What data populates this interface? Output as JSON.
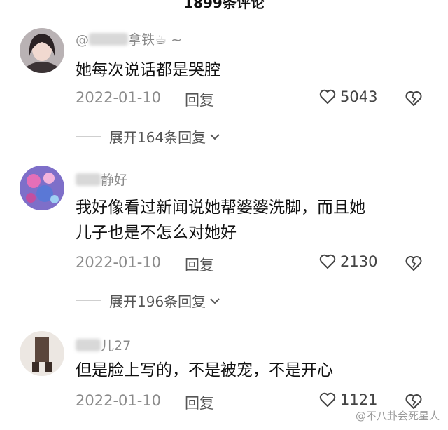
{
  "header": {
    "title": "1899条评论"
  },
  "comments": [
    {
      "username_suffix": "拿铁☕ ~",
      "text": "她每次说话都是哭腔",
      "date": "2022-01-10",
      "reply_label": "回复",
      "likes": "5043",
      "expand_label": "展开164条回复"
    },
    {
      "username_suffix": "静好",
      "text_line1": "我好像看过新闻说她帮婆婆洗脚，而且她",
      "text_line2": "儿子也是不怎么对她好",
      "date": "2022-01-10",
      "reply_label": "回复",
      "likes": "2130",
      "expand_label": "展开196条回复"
    },
    {
      "username_suffix": "儿27",
      "text": "但是脸上写的，不是被宠，不是开心",
      "date": "2022-01-10",
      "reply_label": "回复",
      "likes": "1121"
    }
  ],
  "watermark": "@不八卦会死星人",
  "icons": {
    "like": "heart-outline-icon",
    "dislike": "broken-heart-icon",
    "expand": "chevron-down-icon"
  }
}
